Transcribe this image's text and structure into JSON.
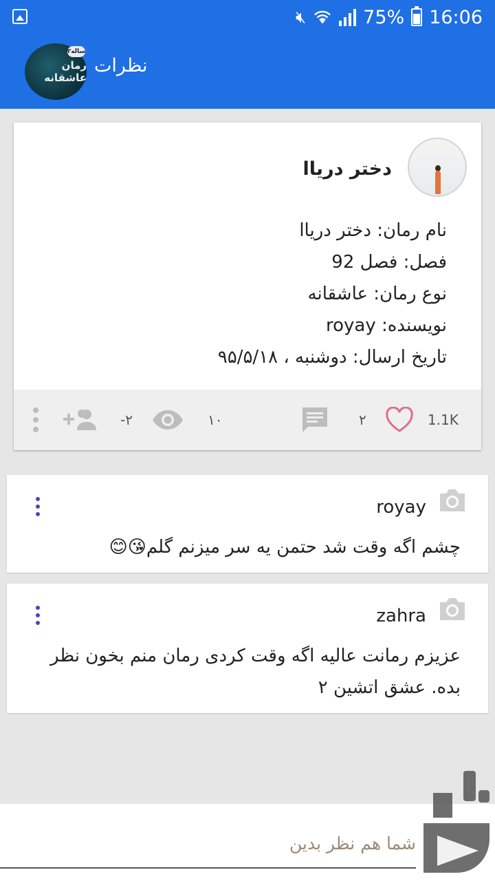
{
  "status_bar": {
    "battery": "75%",
    "time": "16:06"
  },
  "app_bar": {
    "title": "نظرات",
    "logo_text": "رمان عاشقانه",
    "logo_badge": "۲ساله"
  },
  "post": {
    "author": "دختر دریاا",
    "lines": [
      "نام رمان: دختر دریاا",
      "فصل:  فصل 92",
      "نوع رمان: عاشقانه",
      "نویسنده: royay",
      "تاریخ ارسال: دوشنبه ، ۹۵/۵/۱۸"
    ],
    "stats": {
      "likes": "1.1K",
      "comments": "۲",
      "views": "۱۰",
      "followers": "-۲"
    }
  },
  "comments": [
    {
      "user": "royay",
      "text": "چشم اگه وقت شد حتمن یه سر میزنم گلم😘😊"
    },
    {
      "user": "zahra",
      "text": "عزیزم رمانت عالیه اگه وقت کردی رمان منم بخون نظر بده.  عشق اتشین ۲"
    }
  ],
  "input": {
    "placeholder": "شما هم نظر بدین"
  },
  "colors": {
    "primary": "#1f6fe5",
    "like": "#e06c8f",
    "menu_dots": "#5b3fae"
  },
  "icons": [
    "gallery-icon",
    "mute-icon",
    "wifi-icon",
    "signal-icon",
    "battery-icon",
    "heart-icon",
    "comment-icon",
    "eye-icon",
    "add-user-icon",
    "more-vert-icon",
    "camera-icon"
  ]
}
